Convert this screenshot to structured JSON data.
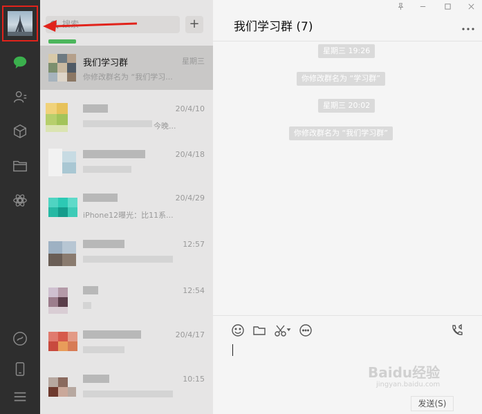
{
  "search": {
    "placeholder": "搜索"
  },
  "add_button": "+",
  "chats": [
    {
      "name": "我们学习群",
      "time": "星期三",
      "message": "你修改群名为 “我们学习..."
    },
    {
      "name": "",
      "time": "20/4/10",
      "message": "今晚..."
    },
    {
      "name": "",
      "time": "20/4/18",
      "message": ""
    },
    {
      "name": "",
      "time": "20/4/29",
      "message": "iPhone12曝光：比11系..."
    },
    {
      "name": "",
      "time": "12:57",
      "message": ""
    },
    {
      "name": "",
      "time": "12:54",
      "message": ""
    },
    {
      "name": "",
      "time": "20/4/17",
      "message": ""
    },
    {
      "name": "",
      "time": "10:15",
      "message": ""
    }
  ],
  "conversation": {
    "title": "我们学习群 (7)",
    "more": "...",
    "messages": [
      {
        "kind": "time",
        "text": "星期三 19:26"
      },
      {
        "kind": "system",
        "text": "你修改群名为 “学习群”"
      },
      {
        "kind": "time",
        "text": "星期三 20:02"
      },
      {
        "kind": "system",
        "text": "你修改群名为 “我们学习群”"
      }
    ]
  },
  "input": {
    "send_label": "发送(S)"
  },
  "watermark": {
    "brand": "Baidu经验",
    "url": "jingyan.baidu.com"
  },
  "colors": {
    "sidebar": "#2e2e2e",
    "chat_list": "#e6e5e5",
    "active_row": "#c9c8c7",
    "panel": "#f5f5f5",
    "accent_green": "#3bb04d",
    "annotation_red": "#e1231b"
  },
  "icons": {
    "nav": [
      "chat-icon",
      "contacts-icon",
      "favorites-icon",
      "files-icon",
      "moments-icon",
      "mini-program-icon",
      "phone-icon",
      "menu-icon"
    ],
    "toolbar": [
      "emoji-icon",
      "folder-icon",
      "scissors-icon",
      "chat-bubble-icon",
      "video-call-icon"
    ]
  }
}
